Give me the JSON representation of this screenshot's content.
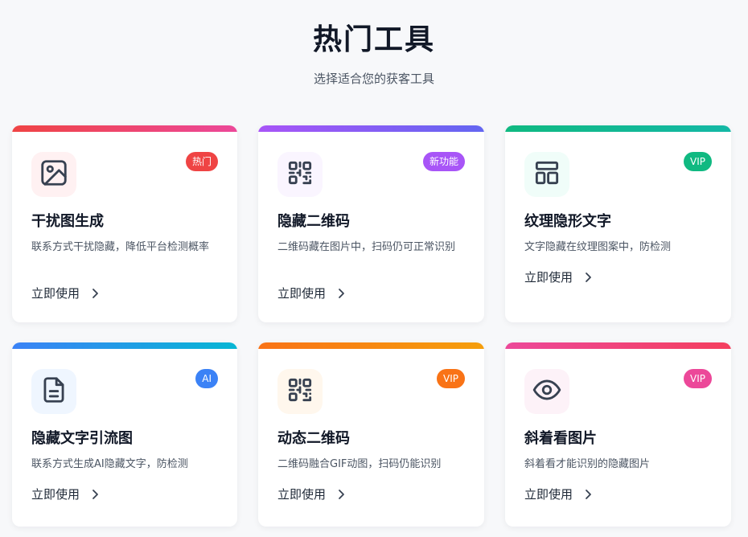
{
  "header": {
    "title": "热门工具",
    "subtitle": "选择适合您的获客工具"
  },
  "cards": [
    {
      "name": "干扰图生成",
      "desc": "联系方式干扰隐藏，降低平台检测概率",
      "badge": "热门",
      "action": "立即使用",
      "icon": "image-icon",
      "bar_color": [
        "#ef4444",
        "#ec4899"
      ],
      "badge_color": "#ef4444",
      "icon_bg": "#fff1f2"
    },
    {
      "name": "隐藏二维码",
      "desc": "二维码藏在图片中，扫码仍可正常识别",
      "badge": "新功能",
      "action": "立即使用",
      "icon": "qr-code-icon",
      "bar_color": [
        "#a855f7",
        "#6366f1"
      ],
      "badge_color": "#a855f7",
      "icon_bg": "#faf5ff"
    },
    {
      "name": "纹理隐形文字",
      "desc": "文字隐藏在纹理图案中，防检测",
      "badge": "VIP",
      "action": "立即使用",
      "icon": "layout-icon",
      "bar_color": [
        "#10b981",
        "#14b8a6"
      ],
      "badge_color": "#10b981",
      "icon_bg": "#f0fdf9"
    },
    {
      "name": "隐藏文字引流图",
      "desc": "联系方式生成AI隐藏文字，防检测",
      "badge": "AI",
      "action": "立即使用",
      "icon": "document-icon",
      "bar_color": [
        "#3b82f6",
        "#06b6d4"
      ],
      "badge_color": "#3b82f6",
      "icon_bg": "#eff6ff"
    },
    {
      "name": "动态二维码",
      "desc": "二维码融合GIF动图，扫码仍能识别",
      "badge": "VIP",
      "action": "立即使用",
      "icon": "qr-code-icon",
      "bar_color": [
        "#f97316",
        "#f59e0b"
      ],
      "badge_color": "#f97316",
      "icon_bg": "#fff7ed"
    },
    {
      "name": "斜着看图片",
      "desc": "斜着看才能识别的隐藏图片",
      "badge": "VIP",
      "action": "立即使用",
      "icon": "eye-icon",
      "bar_color": [
        "#ec4899",
        "#f43f5e"
      ],
      "badge_color": "#ec4899",
      "icon_bg": "#fdf2f8"
    }
  ]
}
